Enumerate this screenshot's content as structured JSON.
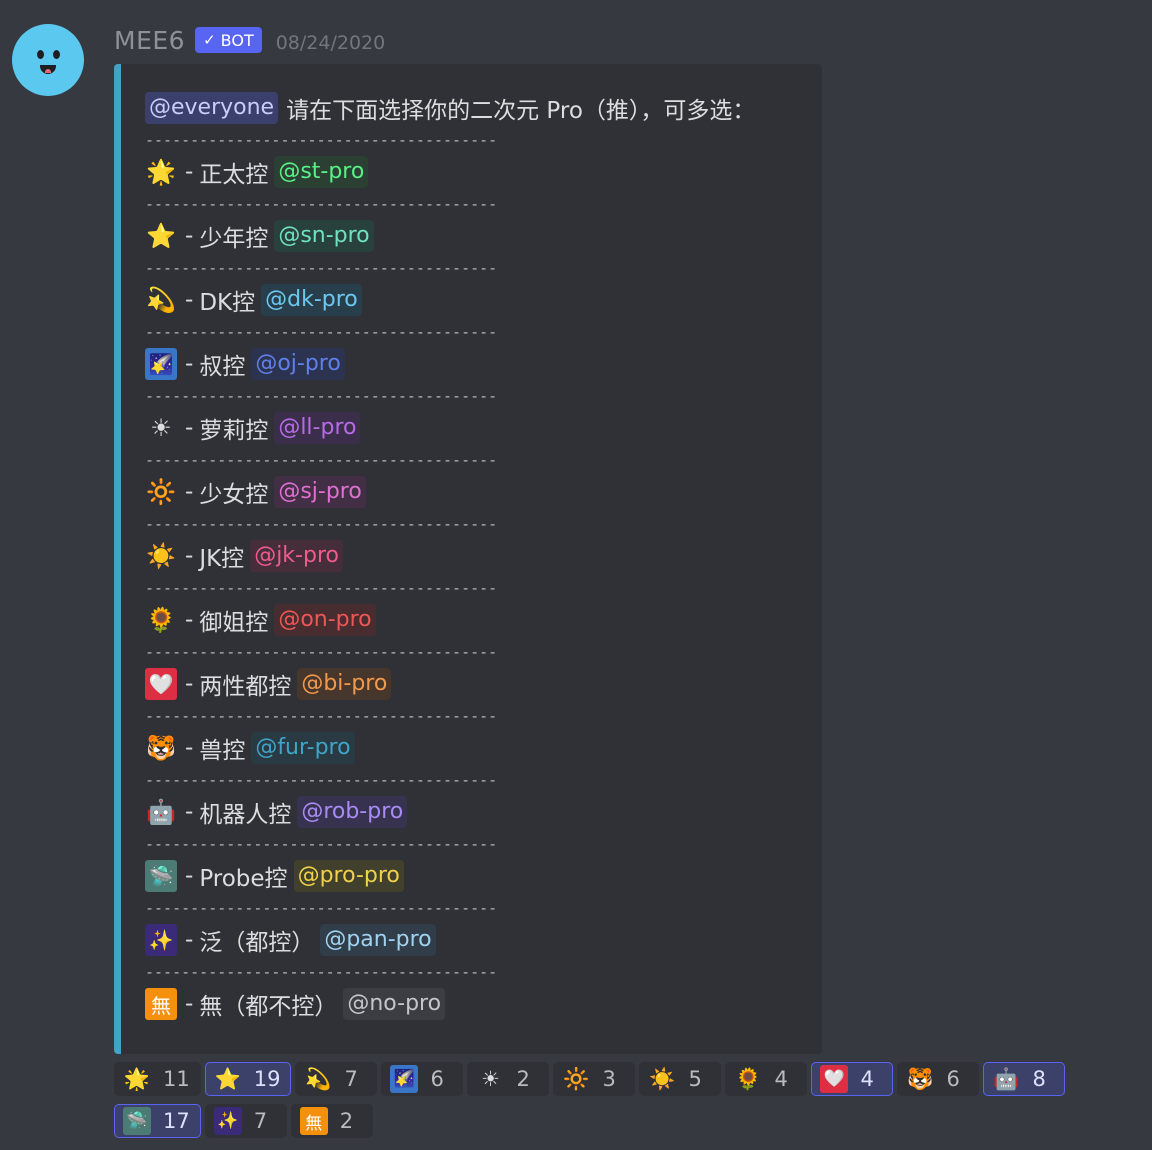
{
  "message": {
    "author": "MEE6",
    "bot_tag": "BOT",
    "bot_check": "✓",
    "timestamp": "08/24/2020",
    "avatar_icon": "smiling-face-avatar"
  },
  "embed": {
    "accent_color": "#3fa4c8",
    "intro_mention": "@everyone",
    "intro_text": "请在下面选择你的二次元 Pro（推），可多选：",
    "divider": "---------------------------------------",
    "dash": "-",
    "items": [
      {
        "emoji": "🌟",
        "icon": "glowing-star-icon",
        "emoji_bg": "",
        "label": "正太控",
        "role": "@st-pro",
        "role_color": "#57f287",
        "role_bg": "#2c3f33"
      },
      {
        "emoji": "⭐",
        "icon": "star-icon",
        "emoji_bg": "",
        "label": "少年控",
        "role": "@sn-pro",
        "role_color": "#6fe0c0",
        "role_bg": "#29413c"
      },
      {
        "emoji": "💫",
        "icon": "dizzy-star-icon",
        "emoji_bg": "",
        "label": "DK控",
        "role": "@dk-pro",
        "role_color": "#6dc7f0",
        "role_bg": "#283f4b"
      },
      {
        "emoji": "🌠",
        "icon": "shooting-star-icon",
        "emoji_bg": "#3a76c8",
        "label": "叔控",
        "role": "@oj-pro",
        "role_color": "#5f80e8",
        "role_bg": "#2c3350"
      },
      {
        "emoji": "☀",
        "icon": "sun-outline-icon",
        "emoji_bg": "",
        "label": "萝莉控",
        "role": "@ll-pro",
        "role_color": "#b66ce8",
        "role_bg": "#3b2e4a"
      },
      {
        "emoji": "🔆",
        "icon": "bright-sun-icon",
        "emoji_bg": "",
        "label": "少女控",
        "role": "@sj-pro",
        "role_color": "#df6fd0",
        "role_bg": "#432f45"
      },
      {
        "emoji": "☀️",
        "icon": "sun-icon",
        "emoji_bg": "",
        "label": "JK控",
        "role": "@jk-pro",
        "role_color": "#ef5b8b",
        "role_bg": "#462d3a"
      },
      {
        "emoji": "🌻",
        "icon": "sunflower-icon",
        "emoji_bg": "",
        "label": "御姐控",
        "role": "@on-pro",
        "role_color": "#ef5656",
        "role_bg": "#472d30"
      },
      {
        "emoji": "🤍",
        "icon": "white-heart-icon",
        "emoji_bg": "#dd2e44",
        "label": "两性都控",
        "role": "@bi-pro",
        "role_color": "#f09a4c",
        "role_bg": "#46362c"
      },
      {
        "emoji": "🐯",
        "icon": "tiger-face-icon",
        "emoji_bg": "",
        "label": "兽控",
        "role": "@fur-pro",
        "role_color": "#3fa4c8",
        "role_bg": "#2a3a43"
      },
      {
        "emoji": "🤖",
        "icon": "robot-face-icon",
        "emoji_bg": "",
        "label": "机器人控",
        "role": "@rob-pro",
        "role_color": "#a98cf2",
        "role_bg": "#363250"
      },
      {
        "emoji": "🛸",
        "icon": "probe-icon",
        "emoji_bg": "#4c7a74",
        "label": "Probe控",
        "role": "@pro-pro",
        "role_color": "#f0d24a",
        "role_bg": "#41402c"
      },
      {
        "emoji": "✨",
        "icon": "milky-way-icon",
        "emoji_bg": "#3a2a78",
        "label": "泛（都控）",
        "role": "@pan-pro",
        "role_color": "#9fd3f0",
        "role_bg": "#313d48"
      },
      {
        "emoji": "無",
        "icon": "mu-button-icon",
        "emoji_bg": "#f4900c",
        "label": "無（都不控）",
        "role": "@no-pro",
        "role_color": "#c3c6cb",
        "role_bg": "#3b3d43"
      }
    ]
  },
  "reactions": [
    {
      "emoji": "🌟",
      "icon": "glowing-star-icon",
      "emoji_bg": "",
      "count": "11",
      "me": false
    },
    {
      "emoji": "⭐",
      "icon": "star-icon",
      "emoji_bg": "",
      "count": "19",
      "me": true
    },
    {
      "emoji": "💫",
      "icon": "dizzy-star-icon",
      "emoji_bg": "",
      "count": "7",
      "me": false
    },
    {
      "emoji": "🌠",
      "icon": "shooting-star-icon",
      "emoji_bg": "#3a76c8",
      "count": "6",
      "me": false
    },
    {
      "emoji": "☀",
      "icon": "sun-outline-icon",
      "emoji_bg": "",
      "count": "2",
      "me": false
    },
    {
      "emoji": "🔆",
      "icon": "bright-sun-icon",
      "emoji_bg": "",
      "count": "3",
      "me": false
    },
    {
      "emoji": "☀️",
      "icon": "sun-icon",
      "emoji_bg": "",
      "count": "5",
      "me": false
    },
    {
      "emoji": "🌻",
      "icon": "sunflower-icon",
      "emoji_bg": "",
      "count": "4",
      "me": false
    },
    {
      "emoji": "🤍",
      "icon": "white-heart-icon",
      "emoji_bg": "#dd2e44",
      "count": "4",
      "me": true
    },
    {
      "emoji": "🐯",
      "icon": "tiger-face-icon",
      "emoji_bg": "",
      "count": "6",
      "me": false
    },
    {
      "emoji": "🤖",
      "icon": "robot-face-icon",
      "emoji_bg": "",
      "count": "8",
      "me": true
    },
    {
      "emoji": "🛸",
      "icon": "probe-icon",
      "emoji_bg": "#4c7a74",
      "count": "17",
      "me": true
    },
    {
      "emoji": "✨",
      "icon": "milky-way-icon",
      "emoji_bg": "#3a2a78",
      "count": "7",
      "me": false
    },
    {
      "emoji": "無",
      "icon": "mu-button-icon",
      "emoji_bg": "#f4900c",
      "count": "2",
      "me": false
    }
  ]
}
